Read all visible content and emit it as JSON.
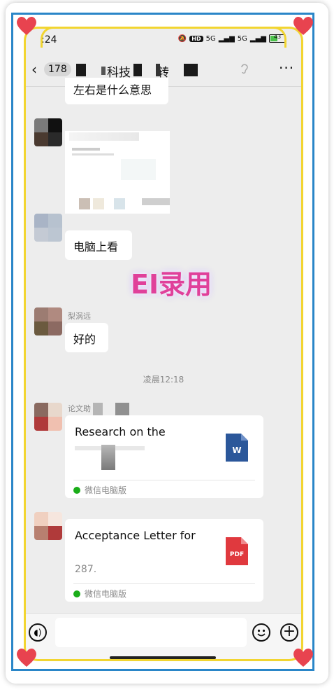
{
  "status_bar": {
    "time": ":24",
    "hd_label": "HD",
    "signal_1": "5G",
    "signal_2": "5G",
    "battery": "43"
  },
  "nav": {
    "unread_count": "178",
    "title_part_1": "科技",
    "title_part_2": "转"
  },
  "messages": {
    "partial_top": "左右是什么意思",
    "msg_1": "电脑上看",
    "sender_2": "梨涡远",
    "msg_2": "好的",
    "timestamp": "凌晨12:18",
    "sender_3": "论文助",
    "file_1": {
      "title": "Research on the",
      "source": "微信电脑版",
      "icon": "word-icon",
      "icon_label": "W"
    },
    "file_2": {
      "title": "Acceptance Letter for",
      "size": "287.",
      "source": "微信电脑版",
      "icon": "pdf-icon",
      "icon_label": "PDF"
    }
  },
  "watermark": "EI录用",
  "colors": {
    "blue_frame": "#2a86c8",
    "yellow_frame": "#f2d531",
    "heart": "#e8434f",
    "word": "#2b579a",
    "pdf": "#e0393e",
    "wechat": "#1aad19"
  }
}
